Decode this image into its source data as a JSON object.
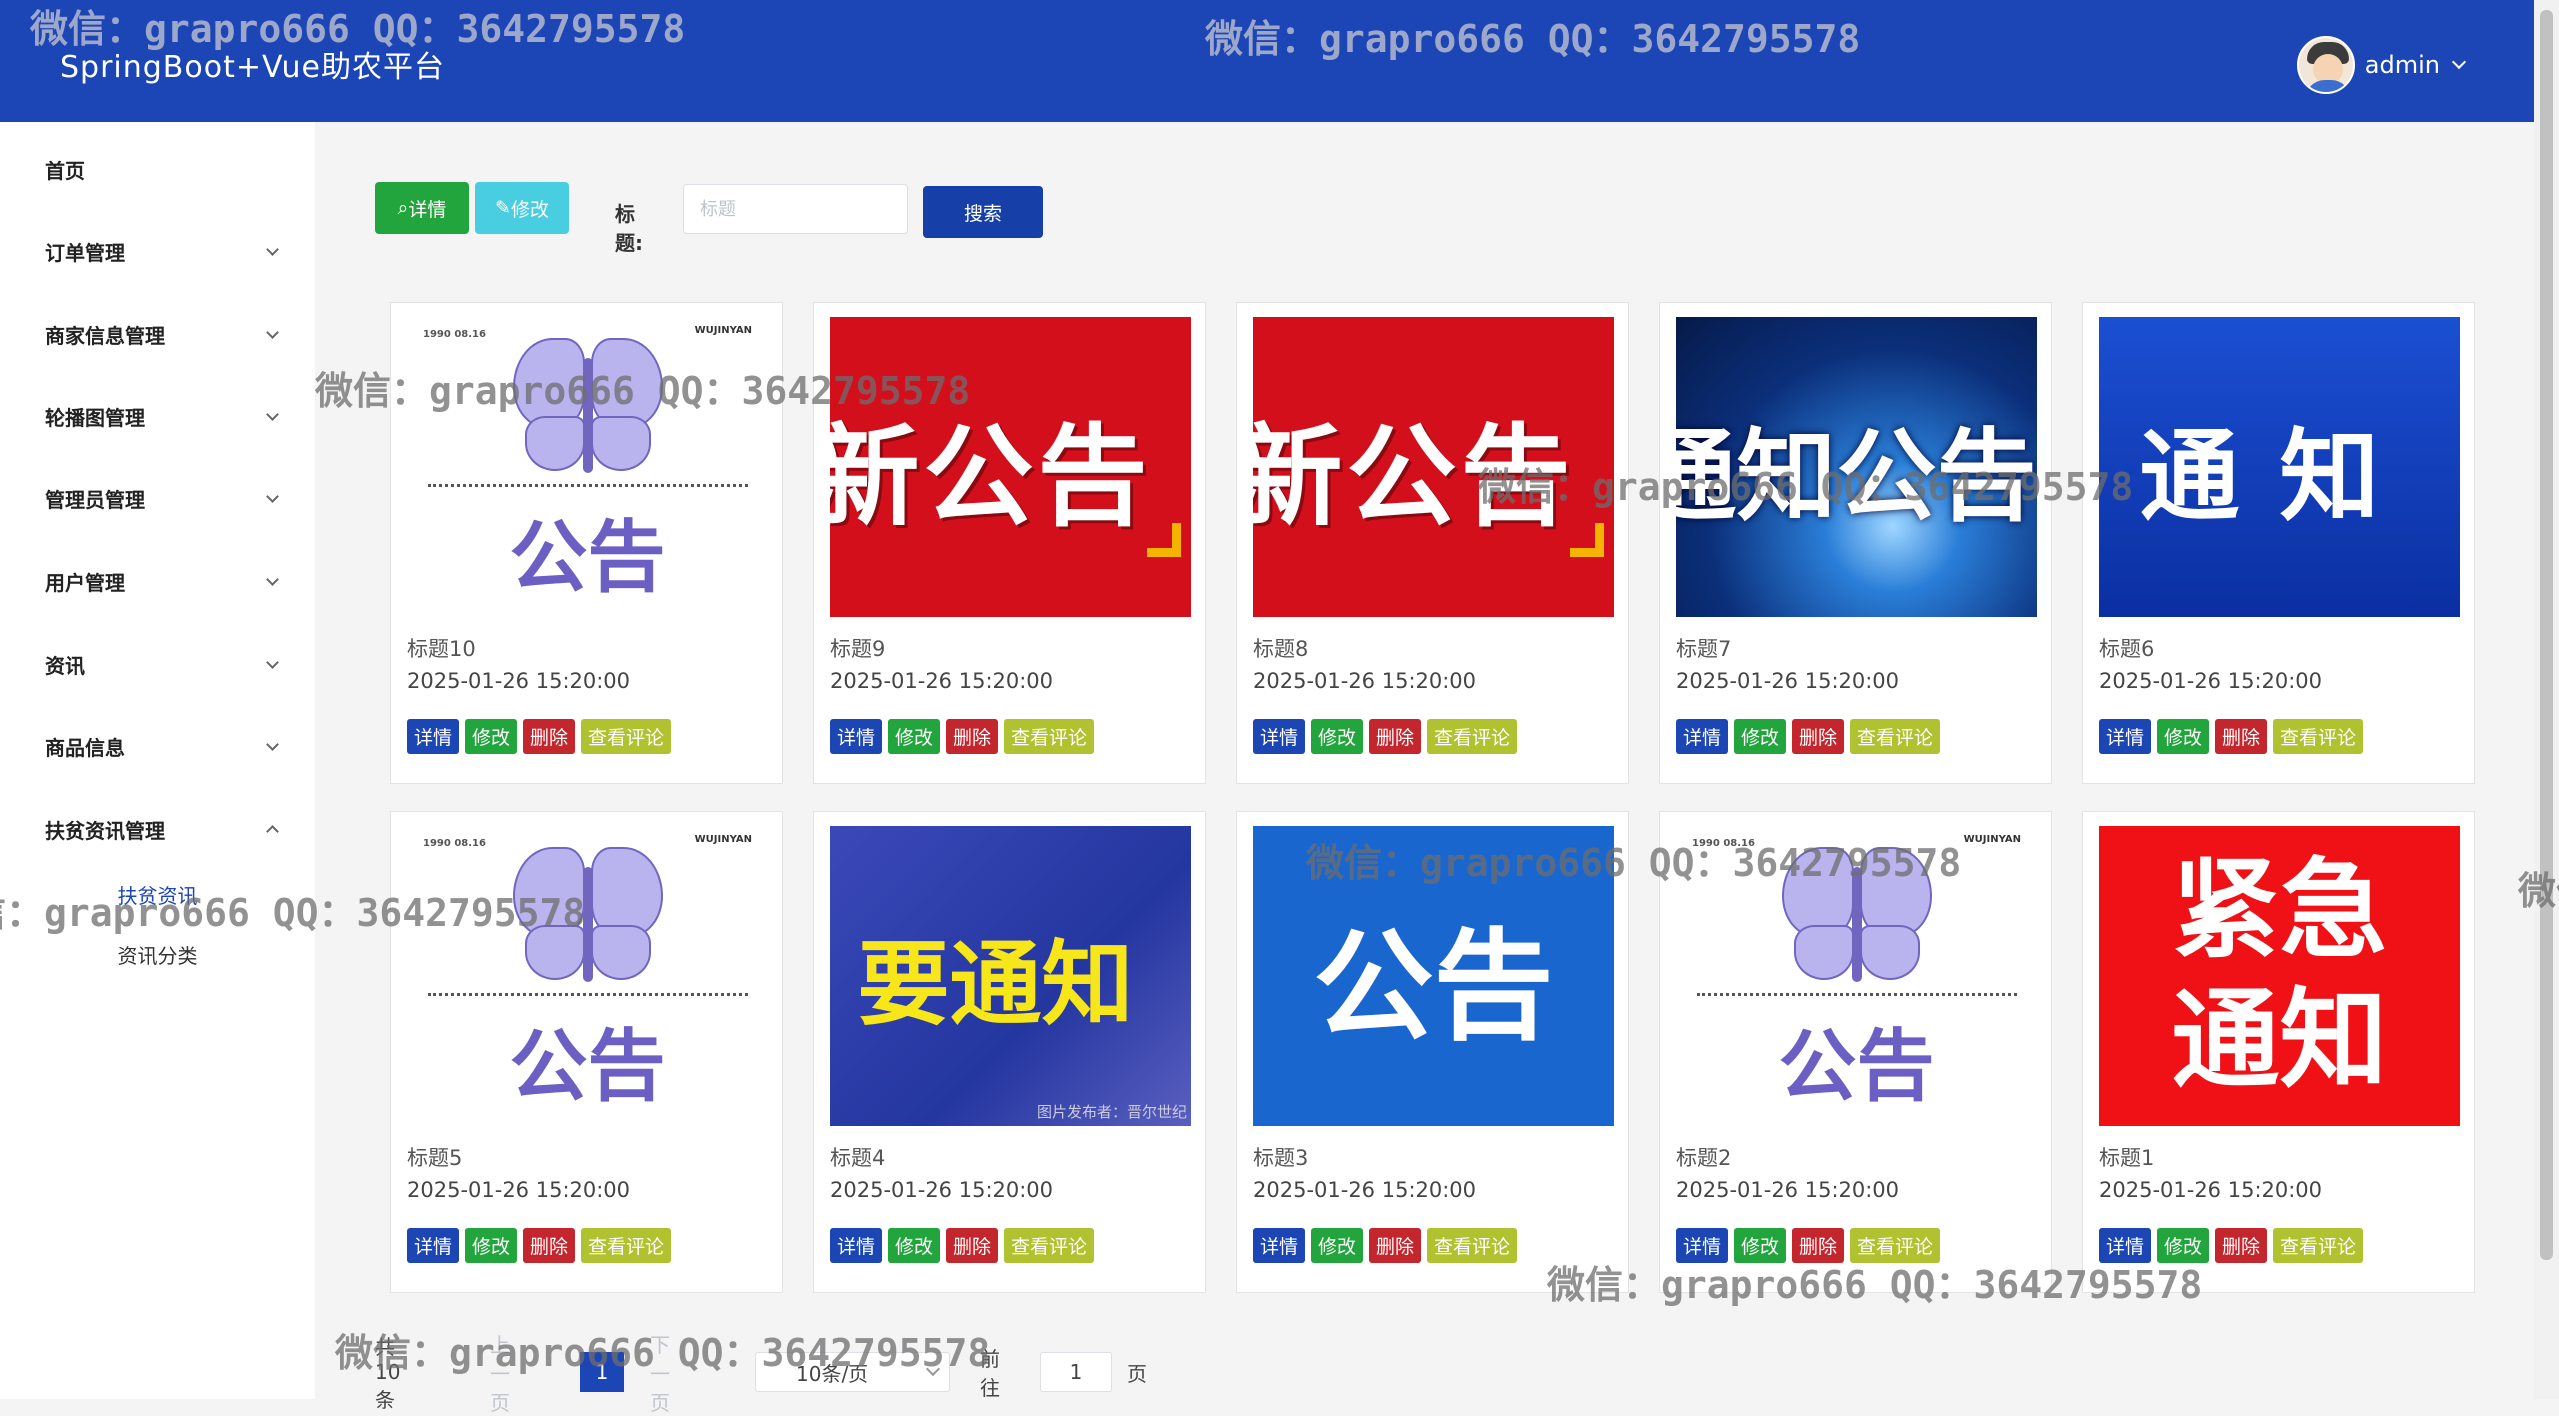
{
  "header": {
    "app_title": "SpringBoot+Vue助农平台",
    "username": "admin"
  },
  "sidebar": {
    "items": [
      {
        "label": "首页"
      },
      {
        "label": "订单管理"
      },
      {
        "label": "商家信息管理"
      },
      {
        "label": "轮播图管理"
      },
      {
        "label": "管理员管理"
      },
      {
        "label": "用户管理"
      },
      {
        "label": "资讯"
      },
      {
        "label": "商品信息"
      },
      {
        "label": "扶贫资讯管理"
      }
    ],
    "subitems": [
      {
        "label": "扶贫资讯",
        "active": true
      },
      {
        "label": "资讯分类",
        "active": false
      }
    ]
  },
  "toolbar": {
    "detail_label": "详情",
    "edit_label": "修改",
    "search_label": "标题:",
    "search_placeholder": "标题",
    "search_value": "",
    "search_button": "搜索"
  },
  "card_buttons": {
    "detail": "详情",
    "edit": "修改",
    "delete": "删除",
    "comments": "查看评论"
  },
  "cards": [
    {
      "title": "标题10",
      "time": "2025-01-26 15:20:00",
      "image_text": "公告",
      "image_tag1": "1990 08.16",
      "image_tag2": "WUJINYAN"
    },
    {
      "title": "标题9",
      "time": "2025-01-26 15:20:00",
      "image_text": "新公告"
    },
    {
      "title": "标题8",
      "time": "2025-01-26 15:20:00",
      "image_text": "新公告"
    },
    {
      "title": "标题7",
      "time": "2025-01-26 15:20:00",
      "image_text": "通知公告"
    },
    {
      "title": "标题6",
      "time": "2025-01-26 15:20:00",
      "image_text": "通知"
    },
    {
      "title": "标题5",
      "time": "2025-01-26 15:20:00",
      "image_text": "公告",
      "image_tag1": "1990 08.16",
      "image_tag2": "WUJINYAN"
    },
    {
      "title": "标题4",
      "time": "2025-01-26 15:20:00",
      "image_text": "要通知",
      "image_caption": "图片发布者：晋尔世纪"
    },
    {
      "title": "标题3",
      "time": "2025-01-26 15:20:00",
      "image_text": "公告"
    },
    {
      "title": "标题2",
      "time": "2025-01-26 15:20:00",
      "image_text": "公告",
      "image_tag1": "1990 08.16",
      "image_tag2": "WUJINYAN"
    },
    {
      "title": "标题1",
      "time": "2025-01-26 15:20:00",
      "image_text_line1": "紧急",
      "image_text_line2": "通知"
    }
  ],
  "pagination": {
    "total": "共 10 条",
    "prev": "上一页",
    "current_page": "1",
    "next": "下一页",
    "page_size": "10条/页",
    "goto_label": "前往",
    "goto_value": "1",
    "page_suffix": "页"
  },
  "watermark": "微信：grapro666 QQ：3642795578",
  "colors": {
    "header_bg": "#1c45b5",
    "detail_green": "#22a53c",
    "edit_cyan": "#49cde0",
    "primary_blue": "#1640a8",
    "delete_red": "#c4262e",
    "comment_olive": "#b1c230"
  }
}
